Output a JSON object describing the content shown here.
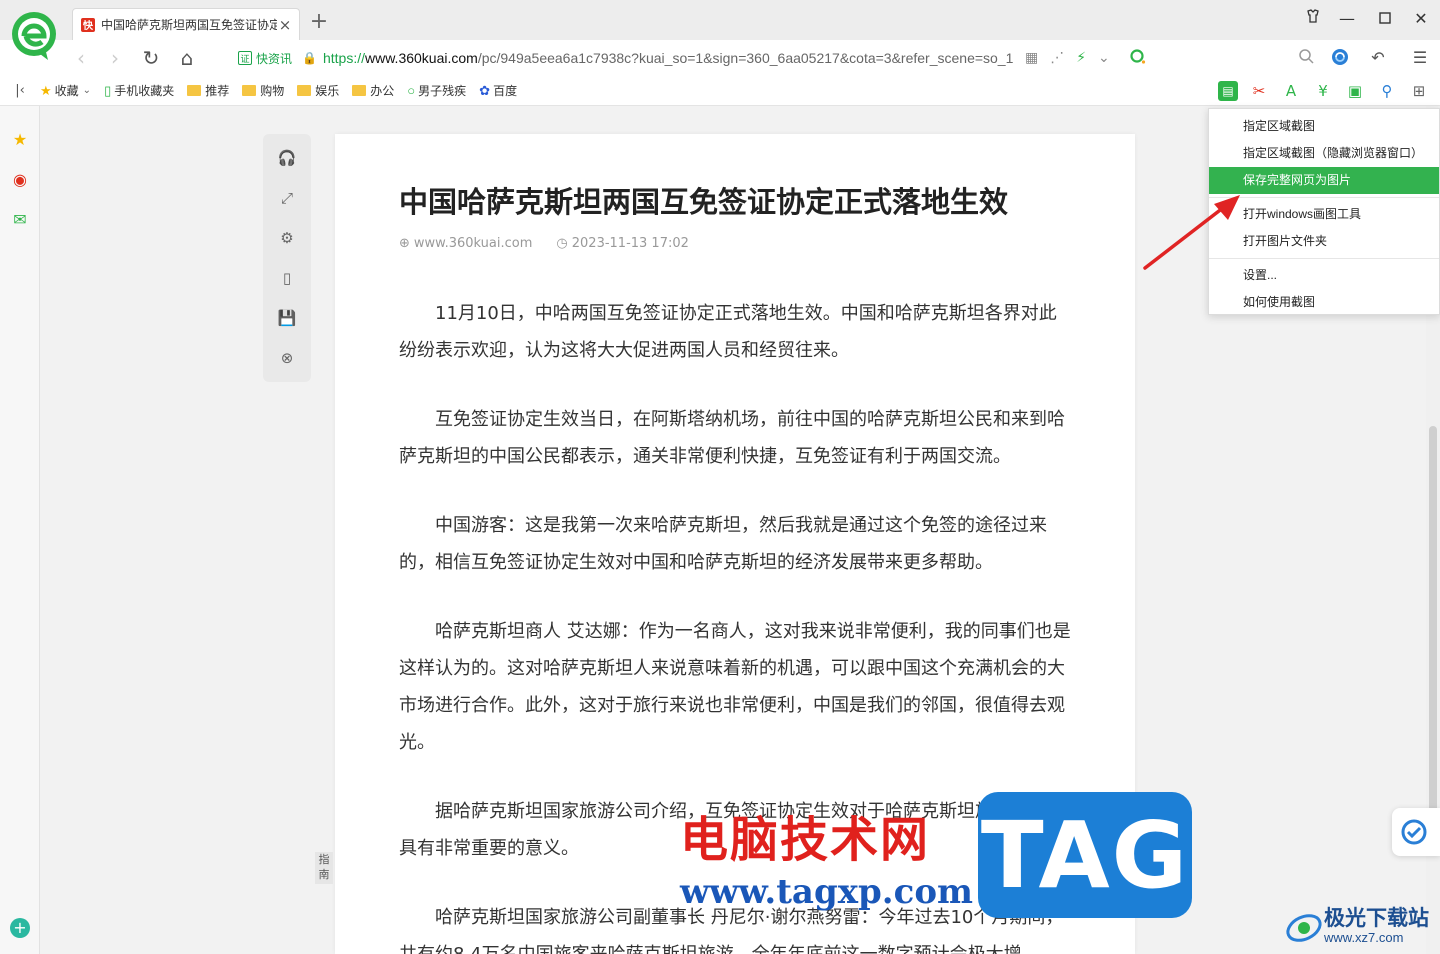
{
  "browser": {
    "tab_title": "中国哈萨克斯坦两国互免签证协定",
    "tab_favicon": "快",
    "new_tab": "+",
    "cert_label": "快资讯",
    "cert_icon_text": "证",
    "url_scheme": "https://",
    "url_host": "www.360kuai.com",
    "url_path": "/pc/949a5eea6a1c7938c?kuai_so=1&sign=360_6aa05217&cota=3&refer_scene=so_1"
  },
  "bookmarks": [
    {
      "label": "收藏",
      "icon": "star-icon"
    },
    {
      "label": "手机收藏夹",
      "icon": "phone-icon"
    },
    {
      "label": "推荐",
      "icon": "folder-icon"
    },
    {
      "label": "购物",
      "icon": "folder-icon"
    },
    {
      "label": "娱乐",
      "icon": "folder-icon"
    },
    {
      "label": "办公",
      "icon": "folder-icon"
    },
    {
      "label": "男子残疾",
      "icon": "search-icon"
    },
    {
      "label": "百度",
      "icon": "paw-icon"
    }
  ],
  "article": {
    "title": "中国哈萨克斯坦两国互免签证协定正式落地生效",
    "source": "www.360kuai.com",
    "datetime": "2023-11-13 17:02",
    "paragraphs": [
      "11月10日，中哈两国互免签证协定正式落地生效。中国和哈萨克斯坦各界对此纷纷表示欢迎，认为这将大大促进两国人员和经贸往来。",
      "互免签证协定生效当日，在阿斯塔纳机场，前往中国的哈萨克斯坦公民和来到哈萨克斯坦的中国公民都表示，通关非常便利快捷，互免签证有利于两国交流。",
      "中国游客：这是我第一次来哈萨克斯坦，然后我就是通过这个免签的途径过来的，相信互免签证协定生效对中国和哈萨克斯坦的经济发展带来更多帮助。",
      "哈萨克斯坦商人 艾达娜：作为一名商人，这对我来说非常便利，我的同事们也是这样认为的。这对哈萨克斯坦人来说意味着新的机遇，可以跟中国这个充满机会的大市场进行合作。此外，这对于旅行来说也非常便利，中国是我们的邻国，很值得去观光。",
      "据哈萨克斯坦国家旅游公司介绍，互免签证协定生效对于哈萨克斯坦旅游业发展具有非常重要的意义。",
      "哈萨克斯坦国家旅游公司副董事长 丹尼尔·谢尔燕努雷：今年过去10个月期间，共有约8.4万名中国旅客来哈萨克斯坦旅游，全年年底前这一数字预计会极大增"
    ]
  },
  "screenshot_menu": {
    "items": [
      "指定区域截图",
      "指定区域截图（隐藏浏览器窗口）",
      "保存完整网页为图片",
      "打开windows画图工具",
      "打开图片文件夹",
      "设置...",
      "如何使用截图"
    ],
    "active_index": 2
  },
  "guide_tab": "指南",
  "watermarks": {
    "site_name": "电脑技术网",
    "site_url": "www.tagxp.com",
    "tag": "TAG",
    "xz_name": "极光下载站",
    "xz_url": "www.xz7.com"
  },
  "colors": {
    "accent_green": "#33b24f",
    "arrow_red": "#e02424",
    "tag_blue": "#1c7fd6"
  }
}
